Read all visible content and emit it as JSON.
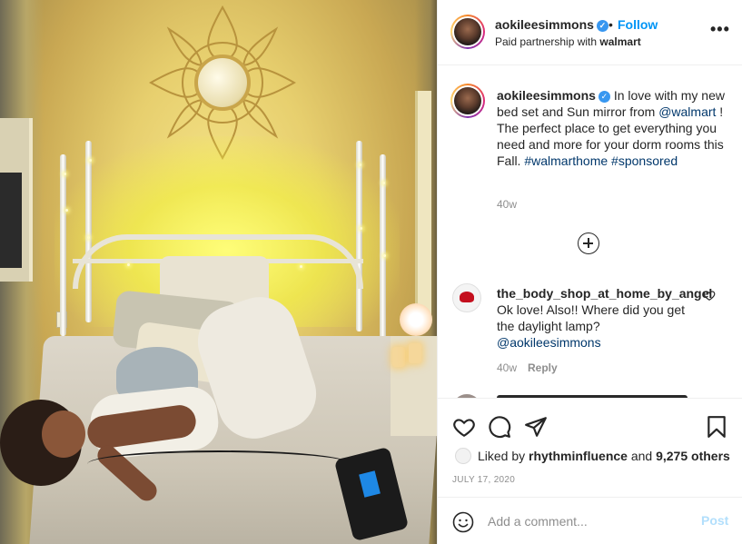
{
  "post": {
    "header": {
      "username": "aokileesimmons",
      "dot": "•",
      "follow_label": "Follow",
      "partnership_prefix": "Paid partnership with ",
      "partner": "walmart",
      "more": "•••"
    },
    "caption": {
      "username": "aokileesimmons",
      "text_1": " In love with my new bed set and Sun mirror from ",
      "mention": "@walmart",
      "text_2": " ! The perfect place to get everything you need and more for your dorm rooms this Fall. ",
      "hashtags": "#walmarthome #sponsored",
      "age": "40w"
    },
    "comments": [
      {
        "username": "the_body_shop_at_home_by_angel",
        "text": " Ok love! Also!! Where did you get the daylight lamp? ",
        "mention": "@aokileesimmons",
        "age": "40w",
        "reply_label": "Reply"
      }
    ],
    "likes": {
      "prefix": "Liked by ",
      "user": "rhythminfluence",
      "middle": " and ",
      "count": "9,275 others"
    },
    "date": "JULY 17, 2020",
    "comment_box": {
      "placeholder": "Add a comment...",
      "post_label": "Post"
    },
    "icons": {
      "verified": "verified-badge-icon",
      "like": "heart-icon",
      "comment": "comment-bubble-icon",
      "share": "paper-plane-icon",
      "save": "bookmark-icon",
      "emoji": "smiley-icon",
      "load_more": "plus-circle-icon"
    },
    "colors": {
      "accent": "#0095f6",
      "link": "#00376b",
      "muted": "#8e8e8e",
      "verified": "#3897f0"
    }
  }
}
